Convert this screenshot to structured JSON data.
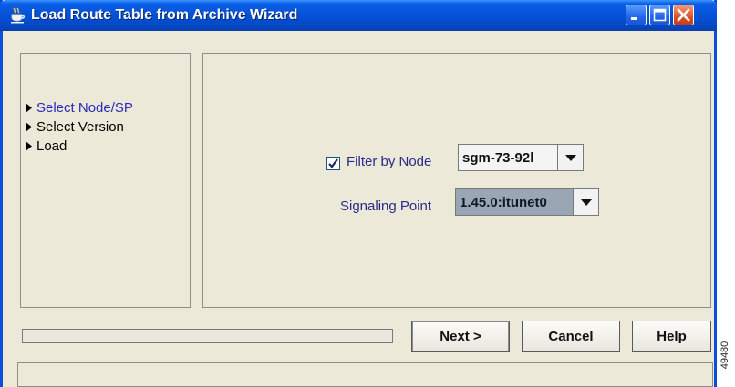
{
  "window": {
    "title": "Load Route Table from Archive Wizard",
    "icon": "java-cup-icon",
    "controls": [
      "minimize-icon",
      "maximize-icon",
      "close-icon"
    ]
  },
  "steps": [
    {
      "label": "Select Node/SP",
      "active": true
    },
    {
      "label": "Select Version",
      "active": false
    },
    {
      "label": "Load",
      "active": false
    }
  ],
  "form": {
    "filter_by_node": {
      "label": "Filter by Node",
      "checked": true,
      "value": "sgm-73-92l"
    },
    "signaling_point": {
      "label": "Signaling Point",
      "value": "1.45.0:itunet0"
    }
  },
  "buttons": {
    "next": "Next >",
    "cancel": "Cancel",
    "help": "Help"
  },
  "progress": {
    "value": 0
  },
  "figure_id": "49480",
  "colors": {
    "titlebar": "#0552d6",
    "active_step": "#2a2ac0",
    "label": "#2a2a8a",
    "close_button": "#e2552c"
  }
}
